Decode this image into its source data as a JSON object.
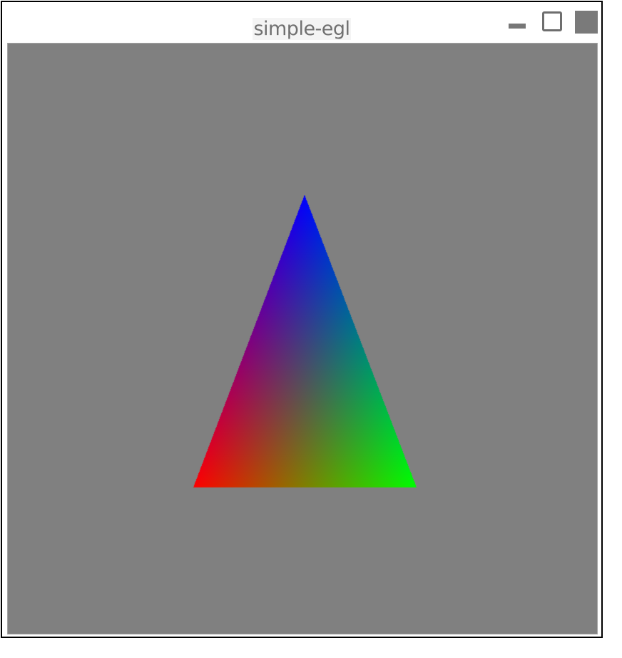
{
  "window": {
    "title": "simple-egl",
    "controls": {
      "minimize_icon": "minimize-icon",
      "maximize_icon": "maximize-icon",
      "close_icon": "close-icon"
    }
  },
  "scene": {
    "clear_color": "#808080",
    "triangle": {
      "vertex_colors": {
        "top": "#0000ff",
        "bottom_left": "#ff0000",
        "bottom_right": "#00ff00"
      }
    }
  }
}
